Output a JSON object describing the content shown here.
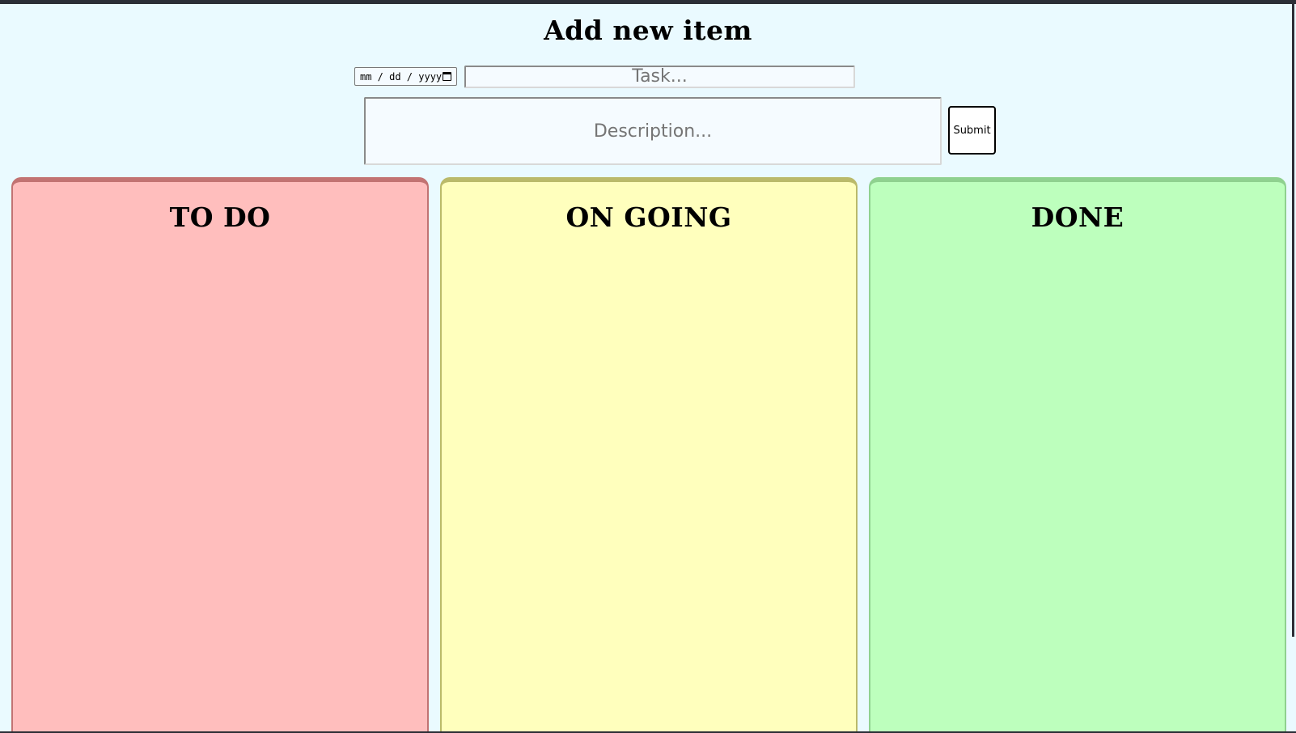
{
  "form": {
    "title": "Add new item",
    "date_placeholder": "mm / dd / yyyy",
    "task_placeholder": "Task...",
    "description_placeholder": "Description...",
    "submit_label": "Submit"
  },
  "columns": [
    {
      "title": "TO DO",
      "color": "#ffbebd",
      "border_color": "#c27372"
    },
    {
      "title": "ON GOING",
      "color": "#ffffbd",
      "border_color": "#baba6a"
    },
    {
      "title": "DONE",
      "color": "#bdffbd",
      "border_color": "#8fd18f"
    }
  ],
  "colors": {
    "page_background": "#eafaff",
    "window_frame": "#2b2e36"
  }
}
